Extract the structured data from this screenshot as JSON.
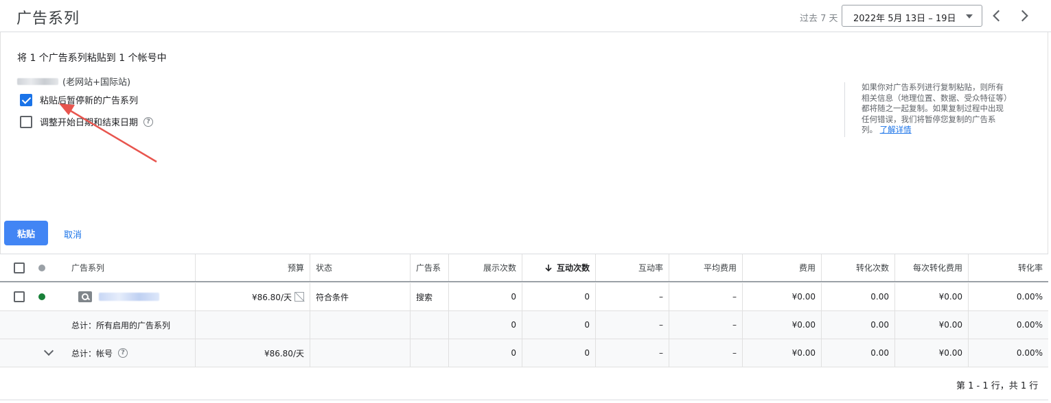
{
  "header": {
    "title": "广告系列",
    "range_label": "过去 7 天",
    "date_range": "2022年 5月 13日 – 19日"
  },
  "panel": {
    "heading": "将 1 个广告系列粘贴到 1 个帐号中",
    "account_suffix": "(老网站+国际站)",
    "option_pause": "粘贴后暂停新的广告系列",
    "option_pause_checked": true,
    "option_adjust_dates": "调整开始日期和结束日期",
    "option_adjust_checked": false,
    "info_text": "如果你对广告系列进行复制粘贴，则所有相关信息（地理位置、数据、受众特征等）都将随之一起复制。如果复制过程中出现任何错误，我们将暂停您复制的广告系列。",
    "info_link": "了解详情",
    "paste_button": "粘贴",
    "cancel_button": "取消"
  },
  "table": {
    "columns": {
      "campaign": "广告系列",
      "budget": "预算",
      "status": "状态",
      "type": "广告系",
      "impressions": "展示次数",
      "interactions": "互动次数",
      "interaction_rate": "互动率",
      "avg_cost": "平均费用",
      "cost": "费用",
      "conversions": "转化次数",
      "cost_per_conv": "每次转化费用",
      "conv_rate": "转化率"
    },
    "sort_icon": "arrow-down-icon",
    "rows": [
      {
        "budget": "¥86.80/天",
        "status": "符合条件",
        "type": "搜索",
        "impressions": "0",
        "interactions": "0",
        "interaction_rate": "–",
        "avg_cost": "–",
        "cost": "¥0.00",
        "conversions": "0.00",
        "cost_per_conv": "¥0.00",
        "conv_rate": "0.00%"
      }
    ],
    "total_enabled": {
      "label": "总计：所有启用的广告系列",
      "impressions": "0",
      "interactions": "0",
      "interaction_rate": "–",
      "avg_cost": "–",
      "cost": "¥0.00",
      "conversions": "0.00",
      "cost_per_conv": "¥0.00",
      "conv_rate": "0.00%"
    },
    "total_account": {
      "label": "总计：帐号",
      "budget": "¥86.80/天",
      "impressions": "0",
      "interactions": "0",
      "interaction_rate": "–",
      "avg_cost": "–",
      "cost": "¥0.00",
      "conversions": "0.00",
      "cost_per_conv": "¥0.00",
      "conv_rate": "0.00%"
    },
    "pagination": "第 1 - 1 行，共 1 行"
  },
  "colors": {
    "accent": "#1a73e8",
    "primary_button": "#4285f4",
    "status_enabled": "#188038",
    "annotation_arrow": "#e8554e"
  }
}
